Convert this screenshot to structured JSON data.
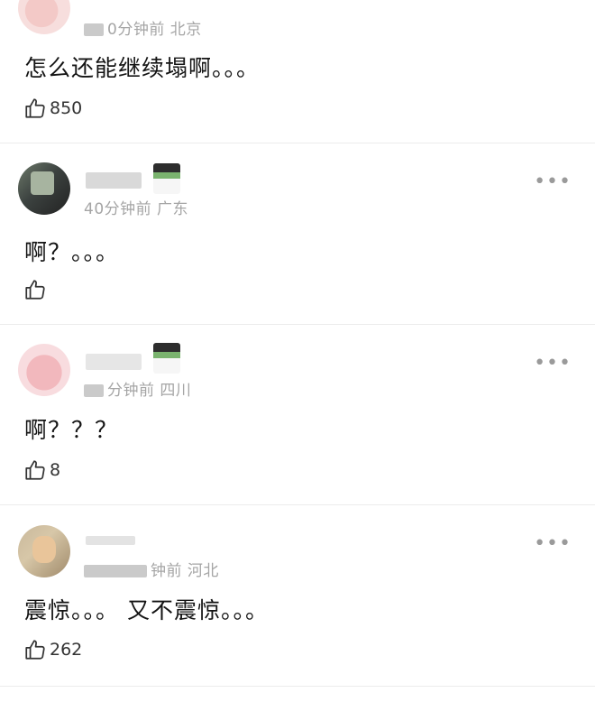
{
  "comments": [
    {
      "name": "",
      "time": "0分钟前",
      "location": "北京",
      "text": "怎么还能继续塌啊。。。",
      "likes": "850",
      "avatar": "avatar-pink-cartoon"
    },
    {
      "name": "",
      "time": "40分钟前",
      "location": "广东",
      "text": "啊？。。。",
      "likes": "",
      "avatar": "avatar-dark-photo"
    },
    {
      "name": "",
      "time": "分钟前",
      "location": "四川",
      "text": "啊？？？",
      "likes": "8",
      "avatar": "avatar-pink-pig"
    },
    {
      "name": "",
      "time": "钟前",
      "location": "河北",
      "text": "震惊。。。 又不震惊。。。",
      "likes": "262",
      "avatar": "avatar-person-photo"
    }
  ],
  "more_label": "•••",
  "icons": {
    "like": "thumbs-up-icon",
    "more": "more-options-icon"
  }
}
